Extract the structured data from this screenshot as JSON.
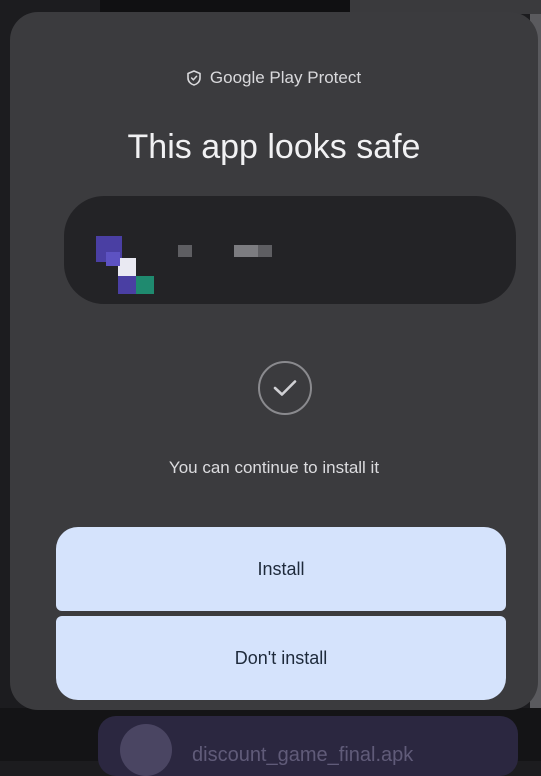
{
  "dialog": {
    "header_label": "Google Play Protect",
    "header_icon": "shield-icon",
    "title": "This app looks safe",
    "status_icon": "checkmark-icon",
    "message": "You can continue to install it"
  },
  "app": {
    "icon": "app-icon",
    "name_redacted": true
  },
  "buttons": {
    "install_label": "Install",
    "dont_install_label": "Don't install"
  },
  "background": {
    "partial_text": "discount_game_final.apk"
  },
  "colors": {
    "dialog_bg": "#3b3b3e",
    "card_bg": "#232326",
    "button_bg": "#d5e3fc",
    "button_text": "#1e2a3b"
  }
}
